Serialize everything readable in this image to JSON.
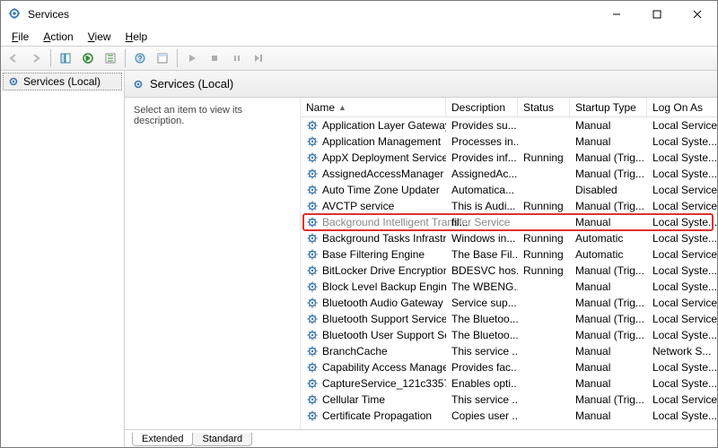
{
  "window": {
    "title": "Services"
  },
  "menu": {
    "file": "File",
    "action": "Action",
    "view": "View",
    "help": "Help"
  },
  "tree": {
    "root": "Services (Local)"
  },
  "header": {
    "title": "Services (Local)"
  },
  "desc_pane": {
    "prompt": "Select an item to view its description."
  },
  "columns": {
    "name": "Name",
    "description": "Description",
    "status": "Status",
    "startup": "Startup Type",
    "logon": "Log On As"
  },
  "tabs": {
    "extended": "Extended",
    "standard": "Standard"
  },
  "services": [
    {
      "name": "Application Layer Gateway ...",
      "desc": "Provides su...",
      "status": "",
      "startup": "Manual",
      "logon": "Local Service"
    },
    {
      "name": "Application Management",
      "desc": "Processes in...",
      "status": "",
      "startup": "Manual",
      "logon": "Local Syste..."
    },
    {
      "name": "AppX Deployment Service (...",
      "desc": "Provides inf...",
      "status": "Running",
      "startup": "Manual (Trig...",
      "logon": "Local Syste..."
    },
    {
      "name": "AssignedAccessManager Se...",
      "desc": "AssignedAc...",
      "status": "",
      "startup": "Manual (Trig...",
      "logon": "Local Syste..."
    },
    {
      "name": "Auto Time Zone Updater",
      "desc": "Automatica...",
      "status": "",
      "startup": "Disabled",
      "logon": "Local Service"
    },
    {
      "name": "AVCTP service",
      "desc": "This is Audi...",
      "status": "Running",
      "startup": "Manual (Trig...",
      "logon": "Local Service"
    },
    {
      "name": "Background Intelligent Transfer Service",
      "desc": "fil...",
      "status": "",
      "startup": "Manual",
      "logon": "Local Syste...",
      "highlight": true
    },
    {
      "name": "Background Tasks Infrastruc...",
      "desc": "Windows in...",
      "status": "Running",
      "startup": "Automatic",
      "logon": "Local Syste..."
    },
    {
      "name": "Base Filtering Engine",
      "desc": "The Base Fil...",
      "status": "Running",
      "startup": "Automatic",
      "logon": "Local Service"
    },
    {
      "name": "BitLocker Drive Encryption ...",
      "desc": "BDESVC hos...",
      "status": "Running",
      "startup": "Manual (Trig...",
      "logon": "Local Syste..."
    },
    {
      "name": "Block Level Backup Engine ...",
      "desc": "The WBENG...",
      "status": "",
      "startup": "Manual",
      "logon": "Local Syste..."
    },
    {
      "name": "Bluetooth Audio Gateway S...",
      "desc": "Service sup...",
      "status": "",
      "startup": "Manual (Trig...",
      "logon": "Local Service"
    },
    {
      "name": "Bluetooth Support Service",
      "desc": "The Bluetoo...",
      "status": "",
      "startup": "Manual (Trig...",
      "logon": "Local Service"
    },
    {
      "name": "Bluetooth User Support Ser...",
      "desc": "The Bluetoo...",
      "status": "",
      "startup": "Manual (Trig...",
      "logon": "Local Syste..."
    },
    {
      "name": "BranchCache",
      "desc": "This service ...",
      "status": "",
      "startup": "Manual",
      "logon": "Network S..."
    },
    {
      "name": "Capability Access Manager ...",
      "desc": "Provides fac...",
      "status": "",
      "startup": "Manual",
      "logon": "Local Syste..."
    },
    {
      "name": "CaptureService_121c3357",
      "desc": "Enables opti...",
      "status": "",
      "startup": "Manual",
      "logon": "Local Syste..."
    },
    {
      "name": "Cellular Time",
      "desc": "This service ...",
      "status": "",
      "startup": "Manual (Trig...",
      "logon": "Local Service"
    },
    {
      "name": "Certificate Propagation",
      "desc": "Copies user ...",
      "status": "",
      "startup": "Manual",
      "logon": "Local Syste..."
    }
  ]
}
